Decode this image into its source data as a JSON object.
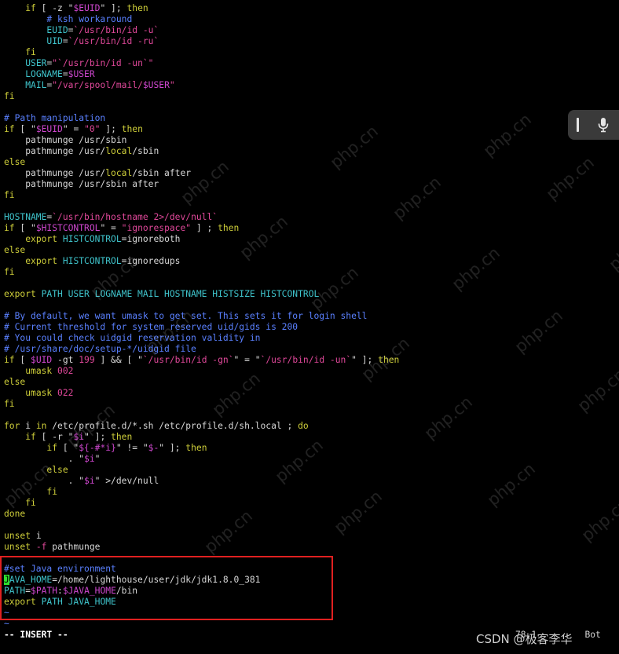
{
  "editor": {
    "lines": [
      [
        {
          "t": "    "
        },
        {
          "t": "if",
          "c": "kw"
        },
        {
          "t": " [ -z \""
        },
        {
          "t": "$EUID",
          "c": "var"
        },
        {
          "t": "\" ]; "
        },
        {
          "t": "then",
          "c": "kw"
        }
      ],
      [
        {
          "t": "        "
        },
        {
          "t": "# ksh workaround",
          "c": "cmt"
        }
      ],
      [
        {
          "t": "        "
        },
        {
          "t": "EUID",
          "c": "cyan"
        },
        {
          "t": "=",
          "c": "txt"
        },
        {
          "t": "`/usr/bin/id -u`",
          "c": "str"
        }
      ],
      [
        {
          "t": "        "
        },
        {
          "t": "UID",
          "c": "cyan"
        },
        {
          "t": "=",
          "c": "txt"
        },
        {
          "t": "`/usr/bin/id -ru`",
          "c": "str"
        }
      ],
      [
        {
          "t": "    "
        },
        {
          "t": "fi",
          "c": "kw"
        }
      ],
      [
        {
          "t": "    "
        },
        {
          "t": "USER",
          "c": "cyan"
        },
        {
          "t": "=",
          "c": "txt"
        },
        {
          "t": "\"`/usr/bin/id -un`\"",
          "c": "str"
        }
      ],
      [
        {
          "t": "    "
        },
        {
          "t": "LOGNAME",
          "c": "cyan"
        },
        {
          "t": "=",
          "c": "txt"
        },
        {
          "t": "$USER",
          "c": "var"
        }
      ],
      [
        {
          "t": "    "
        },
        {
          "t": "MAIL",
          "c": "cyan"
        },
        {
          "t": "=",
          "c": "txt"
        },
        {
          "t": "\"/var/spool/mail/",
          "c": "str"
        },
        {
          "t": "$USER",
          "c": "var"
        },
        {
          "t": "\"",
          "c": "str"
        }
      ],
      [
        {
          "t": "fi",
          "c": "kw"
        }
      ],
      [],
      [
        {
          "t": "# Path manipulation",
          "c": "cmt"
        }
      ],
      [
        {
          "t": "if",
          "c": "kw"
        },
        {
          "t": " [ \""
        },
        {
          "t": "$EUID",
          "c": "var"
        },
        {
          "t": "\" = "
        },
        {
          "t": "\"0\"",
          "c": "str"
        },
        {
          "t": " ]; "
        },
        {
          "t": "then",
          "c": "kw"
        }
      ],
      [
        {
          "t": "    pathmunge /usr/sbin"
        }
      ],
      [
        {
          "t": "    pathmunge /usr/"
        },
        {
          "t": "local",
          "c": "kw"
        },
        {
          "t": "/sbin"
        }
      ],
      [
        {
          "t": "else",
          "c": "kw"
        }
      ],
      [
        {
          "t": "    pathmunge /usr/"
        },
        {
          "t": "local",
          "c": "kw"
        },
        {
          "t": "/sbin after"
        }
      ],
      [
        {
          "t": "    pathmunge /usr/sbin after"
        }
      ],
      [
        {
          "t": "fi",
          "c": "kw"
        }
      ],
      [],
      [
        {
          "t": "HOSTNAME",
          "c": "cyan"
        },
        {
          "t": "=",
          "c": "txt"
        },
        {
          "t": "`/usr/bin/hostname 2>/dev/null`",
          "c": "str"
        }
      ],
      [
        {
          "t": "if",
          "c": "kw"
        },
        {
          "t": " [ \""
        },
        {
          "t": "$HISTCONTROL",
          "c": "var"
        },
        {
          "t": "\" = "
        },
        {
          "t": "\"ignorespace\"",
          "c": "str"
        },
        {
          "t": " ] ; "
        },
        {
          "t": "then",
          "c": "kw"
        }
      ],
      [
        {
          "t": "    "
        },
        {
          "t": "export",
          "c": "kw"
        },
        {
          "t": " "
        },
        {
          "t": "HISTCONTROL",
          "c": "cyan"
        },
        {
          "t": "=ignoreboth"
        }
      ],
      [
        {
          "t": "else",
          "c": "kw"
        }
      ],
      [
        {
          "t": "    "
        },
        {
          "t": "export",
          "c": "kw"
        },
        {
          "t": " "
        },
        {
          "t": "HISTCONTROL",
          "c": "cyan"
        },
        {
          "t": "=ignoredups"
        }
      ],
      [
        {
          "t": "fi",
          "c": "kw"
        }
      ],
      [],
      [
        {
          "t": "export",
          "c": "kw"
        },
        {
          "t": " "
        },
        {
          "t": "PATH USER LOGNAME MAIL HOSTNAME HISTSIZE HISTCONTROL",
          "c": "cyan"
        }
      ],
      [],
      [
        {
          "t": "# By default, we want umask to get set. This sets it for login shell",
          "c": "cmt"
        }
      ],
      [
        {
          "t": "# Current threshold for system reserved uid/gids is 200",
          "c": "cmt"
        }
      ],
      [
        {
          "t": "# You could check uidgid reservation validity in",
          "c": "cmt"
        }
      ],
      [
        {
          "t": "# /usr/share/doc/setup-*/uidgid file",
          "c": "cmt"
        }
      ],
      [
        {
          "t": "if",
          "c": "kw"
        },
        {
          "t": " [ "
        },
        {
          "t": "$UID",
          "c": "var"
        },
        {
          "t": " -gt "
        },
        {
          "t": "199",
          "c": "str"
        },
        {
          "t": " ] && [ \""
        },
        {
          "t": "`/usr/bin/id -gn`",
          "c": "str"
        },
        {
          "t": "\" = \""
        },
        {
          "t": "`/usr/bin/id -un`",
          "c": "str"
        },
        {
          "t": "\" ]; "
        },
        {
          "t": "then",
          "c": "kw"
        }
      ],
      [
        {
          "t": "    "
        },
        {
          "t": "umask",
          "c": "kw"
        },
        {
          "t": " "
        },
        {
          "t": "002",
          "c": "str"
        }
      ],
      [
        {
          "t": "else",
          "c": "kw"
        }
      ],
      [
        {
          "t": "    "
        },
        {
          "t": "umask",
          "c": "kw"
        },
        {
          "t": " "
        },
        {
          "t": "022",
          "c": "str"
        }
      ],
      [
        {
          "t": "fi",
          "c": "kw"
        }
      ],
      [],
      [
        {
          "t": "for",
          "c": "kw"
        },
        {
          "t": " i "
        },
        {
          "t": "in",
          "c": "kw"
        },
        {
          "t": " /etc/profile.d/*.sh /etc/profile.d/sh.local ; "
        },
        {
          "t": "do",
          "c": "kw"
        }
      ],
      [
        {
          "t": "    "
        },
        {
          "t": "if",
          "c": "kw"
        },
        {
          "t": " [ -r \""
        },
        {
          "t": "$i",
          "c": "var"
        },
        {
          "t": "\" ]; "
        },
        {
          "t": "then",
          "c": "kw"
        }
      ],
      [
        {
          "t": "        "
        },
        {
          "t": "if",
          "c": "kw"
        },
        {
          "t": " [ \""
        },
        {
          "t": "${-#*i}",
          "c": "var"
        },
        {
          "t": "\" != \""
        },
        {
          "t": "$-",
          "c": "var"
        },
        {
          "t": "\" ]; "
        },
        {
          "t": "then",
          "c": "kw"
        }
      ],
      [
        {
          "t": "            . \""
        },
        {
          "t": "$i",
          "c": "var"
        },
        {
          "t": "\""
        }
      ],
      [
        {
          "t": "        "
        },
        {
          "t": "else",
          "c": "kw"
        }
      ],
      [
        {
          "t": "            . \""
        },
        {
          "t": "$i",
          "c": "var"
        },
        {
          "t": "\" >/dev/null"
        }
      ],
      [
        {
          "t": "        "
        },
        {
          "t": "fi",
          "c": "kw"
        }
      ],
      [
        {
          "t": "    "
        },
        {
          "t": "fi",
          "c": "kw"
        }
      ],
      [
        {
          "t": "done",
          "c": "kw"
        }
      ],
      [],
      [
        {
          "t": "unset",
          "c": "kw"
        },
        {
          "t": " i"
        }
      ],
      [
        {
          "t": "unset",
          "c": "kw"
        },
        {
          "t": " "
        },
        {
          "t": "-f",
          "c": "str"
        },
        {
          "t": " pathmunge"
        }
      ],
      [],
      [
        {
          "t": "#set Java environment",
          "c": "cmt"
        }
      ],
      [
        {
          "t": "J",
          "c": "cursor"
        },
        {
          "t": "AVA_HOME",
          "c": "cyan"
        },
        {
          "t": "=/home/lighthouse/user/jdk/jdk1.8.0_381"
        }
      ],
      [
        {
          "t": "PATH",
          "c": "cyan"
        },
        {
          "t": "=",
          "c": "txt"
        },
        {
          "t": "$PATH",
          "c": "var"
        },
        {
          "t": ":"
        },
        {
          "t": "$JAVA_HOME",
          "c": "var"
        },
        {
          "t": "/bin"
        }
      ],
      [
        {
          "t": "export",
          "c": "kw"
        },
        {
          "t": " "
        },
        {
          "t": "PATH JAVA_HOME",
          "c": "cyan"
        }
      ],
      [
        {
          "t": "~",
          "c": "cmt"
        }
      ],
      [
        {
          "t": "~",
          "c": "cmt"
        }
      ]
    ],
    "mode": "-- INSERT --",
    "cursor_position": "78,1",
    "scroll_position": "Bot"
  },
  "watermarks": {
    "text": "php.cn",
    "credit": "CSDN @极客李华"
  },
  "icons": {
    "text_cursor": "text-cursor-icon",
    "microphone": "microphone-icon"
  },
  "colors": {
    "background": "#000000",
    "keyword": "#cfcf3a",
    "string": "#e0489a",
    "variable": "#cf47cf",
    "comment": "#5a80ff",
    "identifier": "#3fc4cc",
    "highlight_border": "#e02020",
    "cursor": "#2ee02e"
  }
}
